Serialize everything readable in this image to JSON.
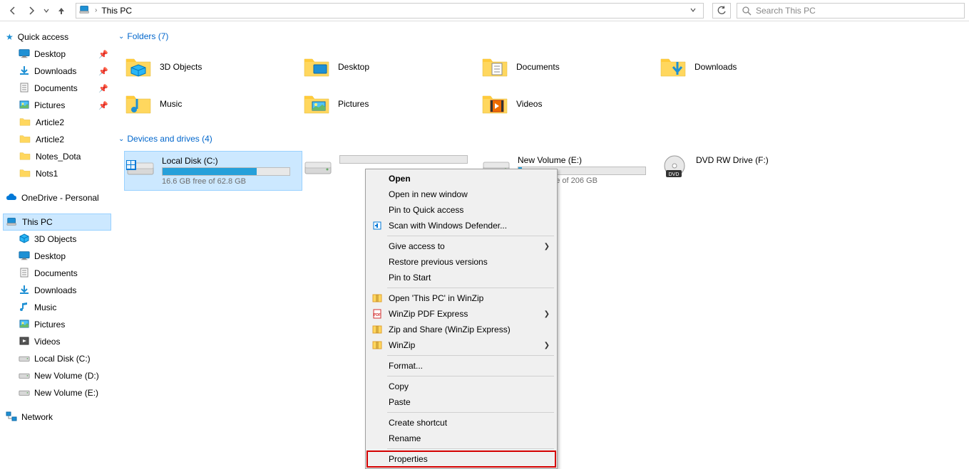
{
  "address": {
    "location": "This PC"
  },
  "search": {
    "placeholder": "Search This PC"
  },
  "sidebar": {
    "quick_access": {
      "label": "Quick access"
    },
    "qa_items": [
      {
        "label": "Desktop",
        "pinned": true,
        "icon": "desktop"
      },
      {
        "label": "Downloads",
        "pinned": true,
        "icon": "downloads"
      },
      {
        "label": "Documents",
        "pinned": true,
        "icon": "documents"
      },
      {
        "label": "Pictures",
        "pinned": true,
        "icon": "pictures"
      },
      {
        "label": "Article2",
        "pinned": false,
        "icon": "folder"
      },
      {
        "label": "Article2",
        "pinned": false,
        "icon": "folder"
      },
      {
        "label": "Notes_Dota",
        "pinned": false,
        "icon": "folder"
      },
      {
        "label": "Nots1",
        "pinned": false,
        "icon": "folder"
      }
    ],
    "onedrive": {
      "label": "OneDrive - Personal"
    },
    "thispc": {
      "label": "This PC",
      "children": [
        {
          "label": "3D Objects",
          "icon": "3dobjects"
        },
        {
          "label": "Desktop",
          "icon": "desktop"
        },
        {
          "label": "Documents",
          "icon": "documents"
        },
        {
          "label": "Downloads",
          "icon": "downloads"
        },
        {
          "label": "Music",
          "icon": "music"
        },
        {
          "label": "Pictures",
          "icon": "pictures"
        },
        {
          "label": "Videos",
          "icon": "videos"
        },
        {
          "label": "Local Disk (C:)",
          "icon": "drive"
        },
        {
          "label": "New Volume (D:)",
          "icon": "drive"
        },
        {
          "label": "New Volume (E:)",
          "icon": "drive"
        }
      ]
    },
    "network": {
      "label": "Network"
    }
  },
  "sections": {
    "folders": {
      "title": "Folders (7)"
    },
    "drives": {
      "title": "Devices and drives (4)"
    }
  },
  "folders": [
    {
      "label": "3D Objects",
      "icon": "3dobjects"
    },
    {
      "label": "Desktop",
      "icon": "desktop-folder"
    },
    {
      "label": "Documents",
      "icon": "documents-folder"
    },
    {
      "label": "Downloads",
      "icon": "downloads-folder"
    },
    {
      "label": "Music",
      "icon": "music-folder"
    },
    {
      "label": "Pictures",
      "icon": "pictures-folder"
    },
    {
      "label": "Videos",
      "icon": "videos-folder"
    }
  ],
  "drives": [
    {
      "label": "Local Disk (C:)",
      "free": "16.6 GB free of 62.8 GB",
      "fill_pct": 74,
      "selected": true,
      "icon": "os-drive",
      "has_bar": true
    },
    {
      "label": "",
      "free": "",
      "fill_pct": 0,
      "selected": false,
      "icon": "drive",
      "has_bar": true,
      "hidden_label": true
    },
    {
      "label": "New Volume (E:)",
      "free": "200 GB free of 206 GB",
      "fill_pct": 3,
      "selected": false,
      "icon": "drive",
      "has_bar": true
    },
    {
      "label": "DVD RW Drive (F:)",
      "free": "",
      "fill_pct": 0,
      "selected": false,
      "icon": "dvd",
      "has_bar": false
    }
  ],
  "context_menu": [
    {
      "type": "item",
      "label": "Open",
      "bold": true
    },
    {
      "type": "item",
      "label": "Open in new window"
    },
    {
      "type": "item",
      "label": "Pin to Quick access"
    },
    {
      "type": "item",
      "label": "Scan with Windows Defender...",
      "icon": "defender"
    },
    {
      "type": "sep"
    },
    {
      "type": "item",
      "label": "Give access to",
      "submenu": true
    },
    {
      "type": "item",
      "label": "Restore previous versions"
    },
    {
      "type": "item",
      "label": "Pin to Start"
    },
    {
      "type": "sep"
    },
    {
      "type": "item",
      "label": "Open 'This PC' in WinZip",
      "icon": "winzip"
    },
    {
      "type": "item",
      "label": "WinZip PDF Express",
      "submenu": true,
      "icon": "pdf"
    },
    {
      "type": "item",
      "label": "Zip and Share (WinZip Express)",
      "icon": "winzip"
    },
    {
      "type": "item",
      "label": "WinZip",
      "submenu": true,
      "icon": "winzip"
    },
    {
      "type": "sep"
    },
    {
      "type": "item",
      "label": "Format..."
    },
    {
      "type": "sep"
    },
    {
      "type": "item",
      "label": "Copy"
    },
    {
      "type": "item",
      "label": "Paste"
    },
    {
      "type": "sep"
    },
    {
      "type": "item",
      "label": "Create shortcut"
    },
    {
      "type": "item",
      "label": "Rename"
    },
    {
      "type": "sep"
    },
    {
      "type": "item",
      "label": "Properties",
      "highlight": true
    }
  ]
}
